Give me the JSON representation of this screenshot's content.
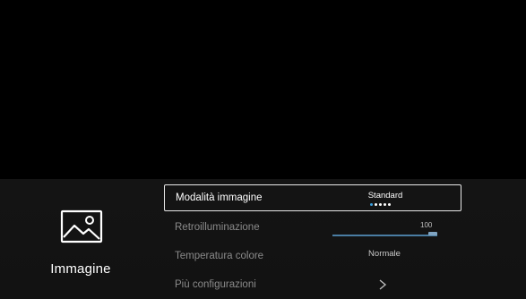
{
  "category": {
    "label": "Immagine",
    "icon": "picture-icon"
  },
  "menu": {
    "items": [
      {
        "label": "Modalità immagine",
        "value": "Standard",
        "type": "selector",
        "dots_total": 5,
        "dots_active_index": 0
      },
      {
        "label": "Retroilluminazione",
        "value": "100",
        "type": "slider",
        "level_percent": 100
      },
      {
        "label": "Temperatura colore",
        "value": "Normale",
        "type": "value"
      },
      {
        "label": "Più configurazioni",
        "type": "submenu",
        "icon": "chevron-right-icon"
      }
    ]
  },
  "colors": {
    "background": "#000000",
    "panel": "#141414",
    "accent": "#3aa0e0",
    "selection_border": "#e8e8e8",
    "inactive_text": "#8a8a8a"
  }
}
